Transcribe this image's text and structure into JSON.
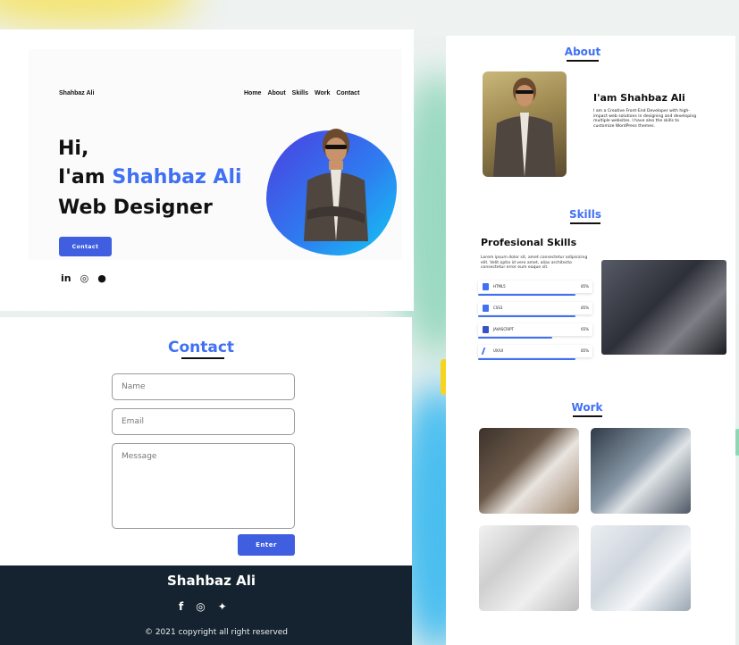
{
  "hero": {
    "brand": "Shahbaz Ali",
    "nav": [
      "Home",
      "About",
      "Skills",
      "Work",
      "Contact"
    ],
    "greeting": "Hi,",
    "intro_prefix": "I'am ",
    "intro_name": "Shahbaz Ali",
    "role": "Web Designer",
    "contact_button": "Contact",
    "social_icons": [
      "linkedin-icon",
      "instagram-icon",
      "github-icon"
    ],
    "social_glyphs": {
      "linkedin": "in",
      "instagram": "◎",
      "github": "●"
    }
  },
  "contact": {
    "title": "Contact",
    "name_placeholder": "Name",
    "email_placeholder": "Email",
    "message_placeholder": "Message",
    "enter_button": "Enter"
  },
  "footer": {
    "name": "Shahbaz Ali",
    "social_glyphs": [
      "f",
      "◎",
      "✦"
    ],
    "copyright": "© 2021 copyright all right reserved"
  },
  "about": {
    "title": "About",
    "heading": "I'am Shahbaz Ali",
    "description": "I am a Creative Front-End Developer with high-impact web solutions in designing and developing multiple websites. I have also the skills to customize WordPress themes."
  },
  "skills": {
    "title": "Skills",
    "heading": "Profesional Skills",
    "description": "Lorem ipsum dolor sit, amet consectetur adipisicing elit. Velit optio id vero amet, alias architecto consectetur error eum eaque sit.",
    "items": [
      {
        "label": "HTML5",
        "percent": "85%",
        "value": 0.85,
        "color": "#4070f4"
      },
      {
        "label": "CSS3",
        "percent": "85%",
        "value": 0.85,
        "color": "#4070f4"
      },
      {
        "label": "JAVASCRIPT",
        "percent": "65%",
        "value": 0.65,
        "color": "#4070f4"
      },
      {
        "label": "UX/UI",
        "percent": "85%",
        "value": 0.85,
        "color": "#4070f4"
      }
    ]
  },
  "work": {
    "title": "Work"
  },
  "colors": {
    "accent": "#4070f4",
    "button": "#3f5fe0",
    "footer": "#14232f"
  }
}
